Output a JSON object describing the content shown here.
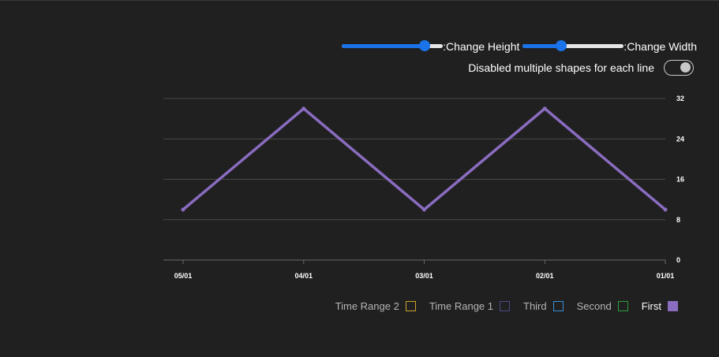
{
  "controls": {
    "height_label": ":Change Height",
    "height_value": 0.82,
    "width_label": ":Change Width",
    "width_value": 0.38,
    "toggle_label": "Disabled multiple shapes for each line",
    "toggle_on": true
  },
  "colors": {
    "background": "#202020",
    "gridline": "#4a4a4a",
    "line": "#8a6cc0",
    "slider_accent": "#1a73e8"
  },
  "chart_data": {
    "type": "line",
    "title": "",
    "xlabel": "",
    "ylabel": "",
    "x": [
      "05/01",
      "04/01",
      "03/01",
      "02/01",
      "01/01"
    ],
    "x_axis_reversed": true,
    "y_axis_position": "right",
    "ylim": [
      0,
      32
    ],
    "yticks": [
      0,
      8,
      16,
      24,
      32
    ],
    "grid": true,
    "legend_position": "bottom-right",
    "series": [
      {
        "name": "First",
        "values": [
          10,
          30,
          10,
          30,
          10
        ],
        "color": "#8a6cc0"
      }
    ],
    "legend": [
      {
        "label": "Time Range 2",
        "color": "#c9a227",
        "filled": false
      },
      {
        "label": "Time Range 1",
        "color": "#4a4a8a",
        "filled": false
      },
      {
        "label": "Third",
        "color": "#3a8fd4",
        "filled": false
      },
      {
        "label": "Second",
        "color": "#2e9e3e",
        "filled": false
      },
      {
        "label": "First",
        "color": "#8a6cc0",
        "filled": true
      }
    ]
  }
}
